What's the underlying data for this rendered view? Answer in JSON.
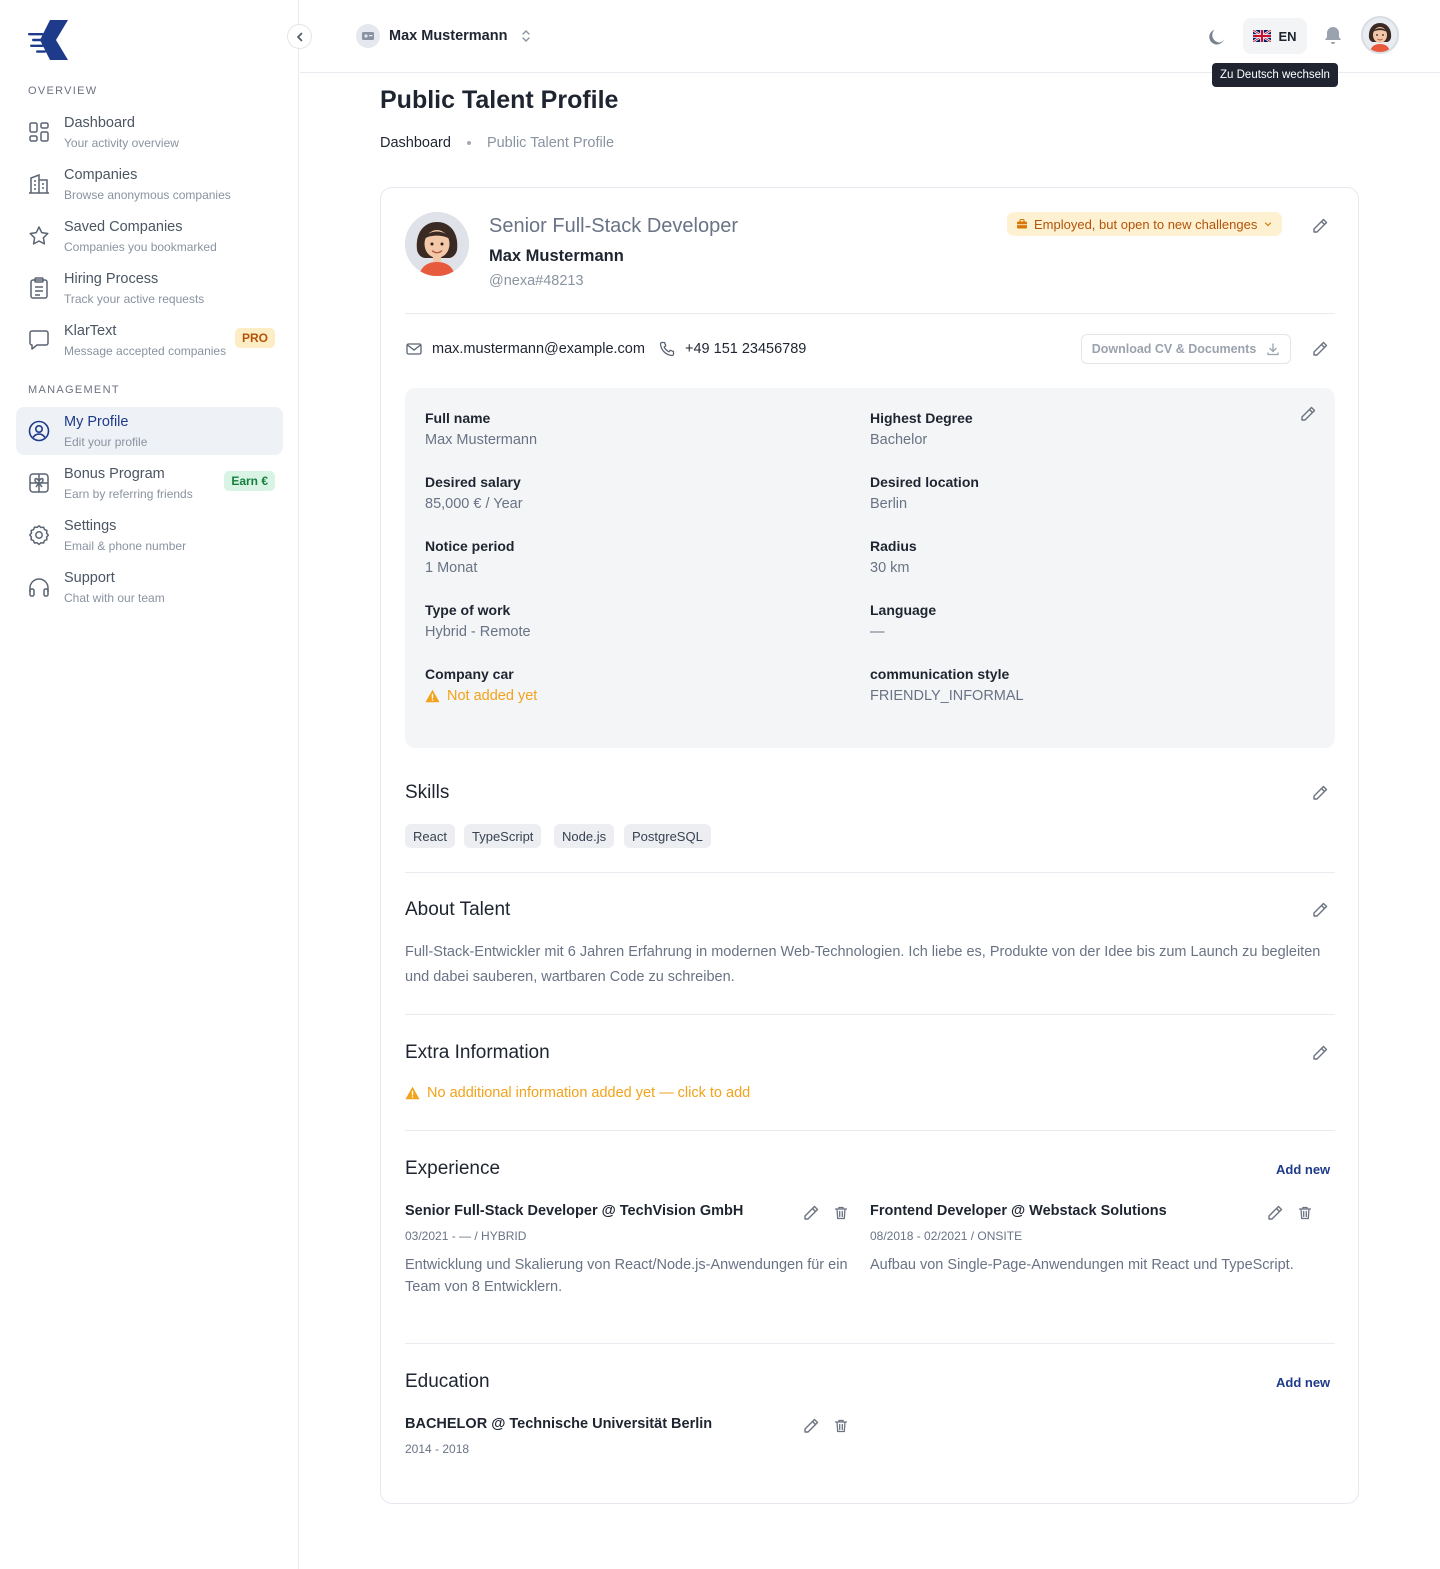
{
  "sidebar": {
    "sections": {
      "overview": "OVERVIEW",
      "management": "MANAGEMENT"
    },
    "items": [
      {
        "title": "Dashboard",
        "subtitle": "Your activity overview",
        "icon": "dashboard-grid-icon"
      },
      {
        "title": "Companies",
        "subtitle": "Browse anonymous companies",
        "icon": "building-icon"
      },
      {
        "title": "Saved Companies",
        "subtitle": "Companies you bookmarked",
        "icon": "star-icon"
      },
      {
        "title": "Hiring Process",
        "subtitle": "Track your active requests",
        "icon": "clipboard-icon"
      },
      {
        "title": "KlarText",
        "subtitle": "Message accepted companies",
        "icon": "chat-bubble-icon",
        "badge": "PRO"
      },
      {
        "title": "My Profile",
        "subtitle": "Edit your profile",
        "icon": "user-circle-icon",
        "active": true
      },
      {
        "title": "Bonus Program",
        "subtitle": "Earn by referring friends",
        "icon": "gift-icon",
        "badge": "Earn €"
      },
      {
        "title": "Settings",
        "subtitle": "Email & phone number",
        "icon": "gear-icon"
      },
      {
        "title": "Support",
        "subtitle": "Chat with our team",
        "icon": "headphones-icon"
      }
    ]
  },
  "topbar": {
    "account_name": "Max Mustermann",
    "language": "EN",
    "tooltip": "Zu Deutsch wechseln"
  },
  "page": {
    "title": "Public Talent Profile",
    "breadcrumb": [
      "Dashboard",
      "Public Talent Profile"
    ]
  },
  "profile": {
    "job_title": "Senior Full-Stack Developer",
    "name": "Max Mustermann",
    "handle": "@nexa#48213",
    "status": "Employed, but open to new challenges",
    "email": "max.mustermann@example.com",
    "phone": "+49 151 23456789",
    "download_label": "Download CV & Documents"
  },
  "details": {
    "left": [
      {
        "label": "Full name",
        "value": "Max Mustermann"
      },
      {
        "label": "Desired salary",
        "value": "85,000 € / Year"
      },
      {
        "label": "Notice period",
        "value": "1 Monat"
      },
      {
        "label": "Type of work",
        "value": "Hybrid - Remote"
      },
      {
        "label": "Company car",
        "value": "Not added yet"
      }
    ],
    "right": [
      {
        "label": "Highest Degree",
        "value": "Bachelor"
      },
      {
        "label": "Desired location",
        "value": "Berlin"
      },
      {
        "label": "Radius",
        "value": "30 km"
      },
      {
        "label": "Language",
        "value": "—"
      },
      {
        "label": "communication style",
        "value": "FRIENDLY_INFORMAL"
      }
    ]
  },
  "skills": {
    "title": "Skills",
    "items": [
      "React",
      "TypeScript",
      "Node.js",
      "PostgreSQL"
    ]
  },
  "about": {
    "title": "About Talent",
    "text": "Full-Stack-Entwickler mit 6 Jahren Erfahrung in modernen Web-Technologien. Ich liebe es, Produkte von der Idee bis zum Launch zu begleiten und dabei sauberen, wartbaren Code zu schreiben."
  },
  "extra": {
    "title": "Extra Information",
    "empty_text": "No additional information added yet — click to add"
  },
  "experience": {
    "title": "Experience",
    "add_label": "Add new",
    "items": [
      {
        "title": "Senior Full-Stack Developer @ TechVision GmbH",
        "meta": "03/2021 - — / HYBRID",
        "desc": "Entwicklung und Skalierung von React/Node.js-Anwendungen für ein Team von 8 Entwicklern."
      },
      {
        "title": "Frontend Developer @ Webstack Solutions",
        "meta": "08/2018 - 02/2021 / ONSITE",
        "desc": "Aufbau von Single-Page-Anwendungen mit React und TypeScript."
      }
    ]
  },
  "education": {
    "title": "Education",
    "add_label": "Add new",
    "items": [
      {
        "title": "BACHELOR @ Technische Universität Berlin",
        "meta": "2014 - 2018"
      }
    ]
  },
  "colors": {
    "primary": "#1e3a8a",
    "warning": "#f2a21b",
    "status_bg": "#fdf1d2",
    "muted_text": "#697385"
  }
}
